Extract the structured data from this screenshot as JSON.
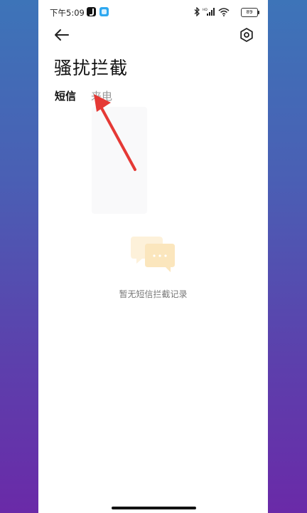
{
  "status_bar": {
    "time": "下午5:09",
    "battery": "89"
  },
  "header": {
    "title": "骚扰拦截"
  },
  "tabs": [
    {
      "label": "短信",
      "active": true
    },
    {
      "label": "来电",
      "active": false
    }
  ],
  "empty_state": {
    "icon": "chat-bubbles-icon",
    "text": "暂无短信拦截记录"
  },
  "colors": {
    "annotation_arrow": "#e53935",
    "illustration": "#fbe6bd"
  }
}
